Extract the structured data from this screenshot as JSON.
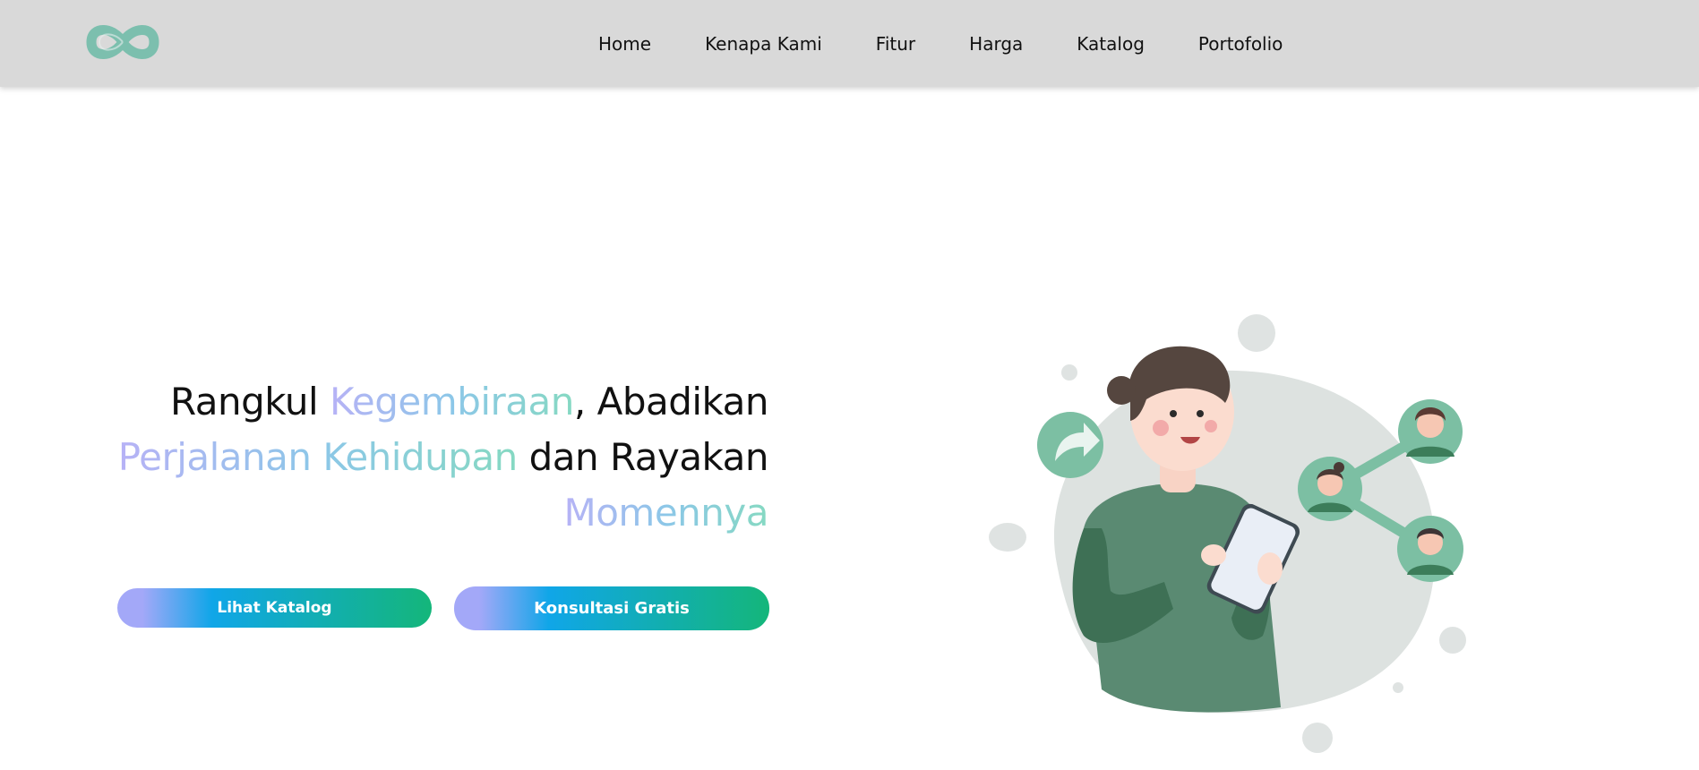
{
  "nav": {
    "logo": "infinity-logo",
    "links": [
      "Home",
      "Kenapa Kami",
      "Fitur",
      "Harga",
      "Katalog",
      "Portofolio"
    ]
  },
  "hero": {
    "title_parts": {
      "p1": "Rangkul ",
      "p2": "Kegembiraan",
      "p3": ", Abadikan",
      "p4": "Perjalanan Kehidupan",
      "p5": " dan Rayakan",
      "p6": "Momennya"
    },
    "buttons": {
      "katalog": "Lihat Katalog",
      "konsultasi": "Konsultasi Gratis"
    },
    "illustration": "person-with-tablet-sharing-illustration"
  },
  "colors": {
    "navbar_bg": "#d9d9d9",
    "logo": "#7cbfae",
    "gradient_start": "#a3a8f8",
    "gradient_mid": "#10a6e8",
    "gradient_end": "#14b67a",
    "illustration_green": "#5a8a72"
  }
}
